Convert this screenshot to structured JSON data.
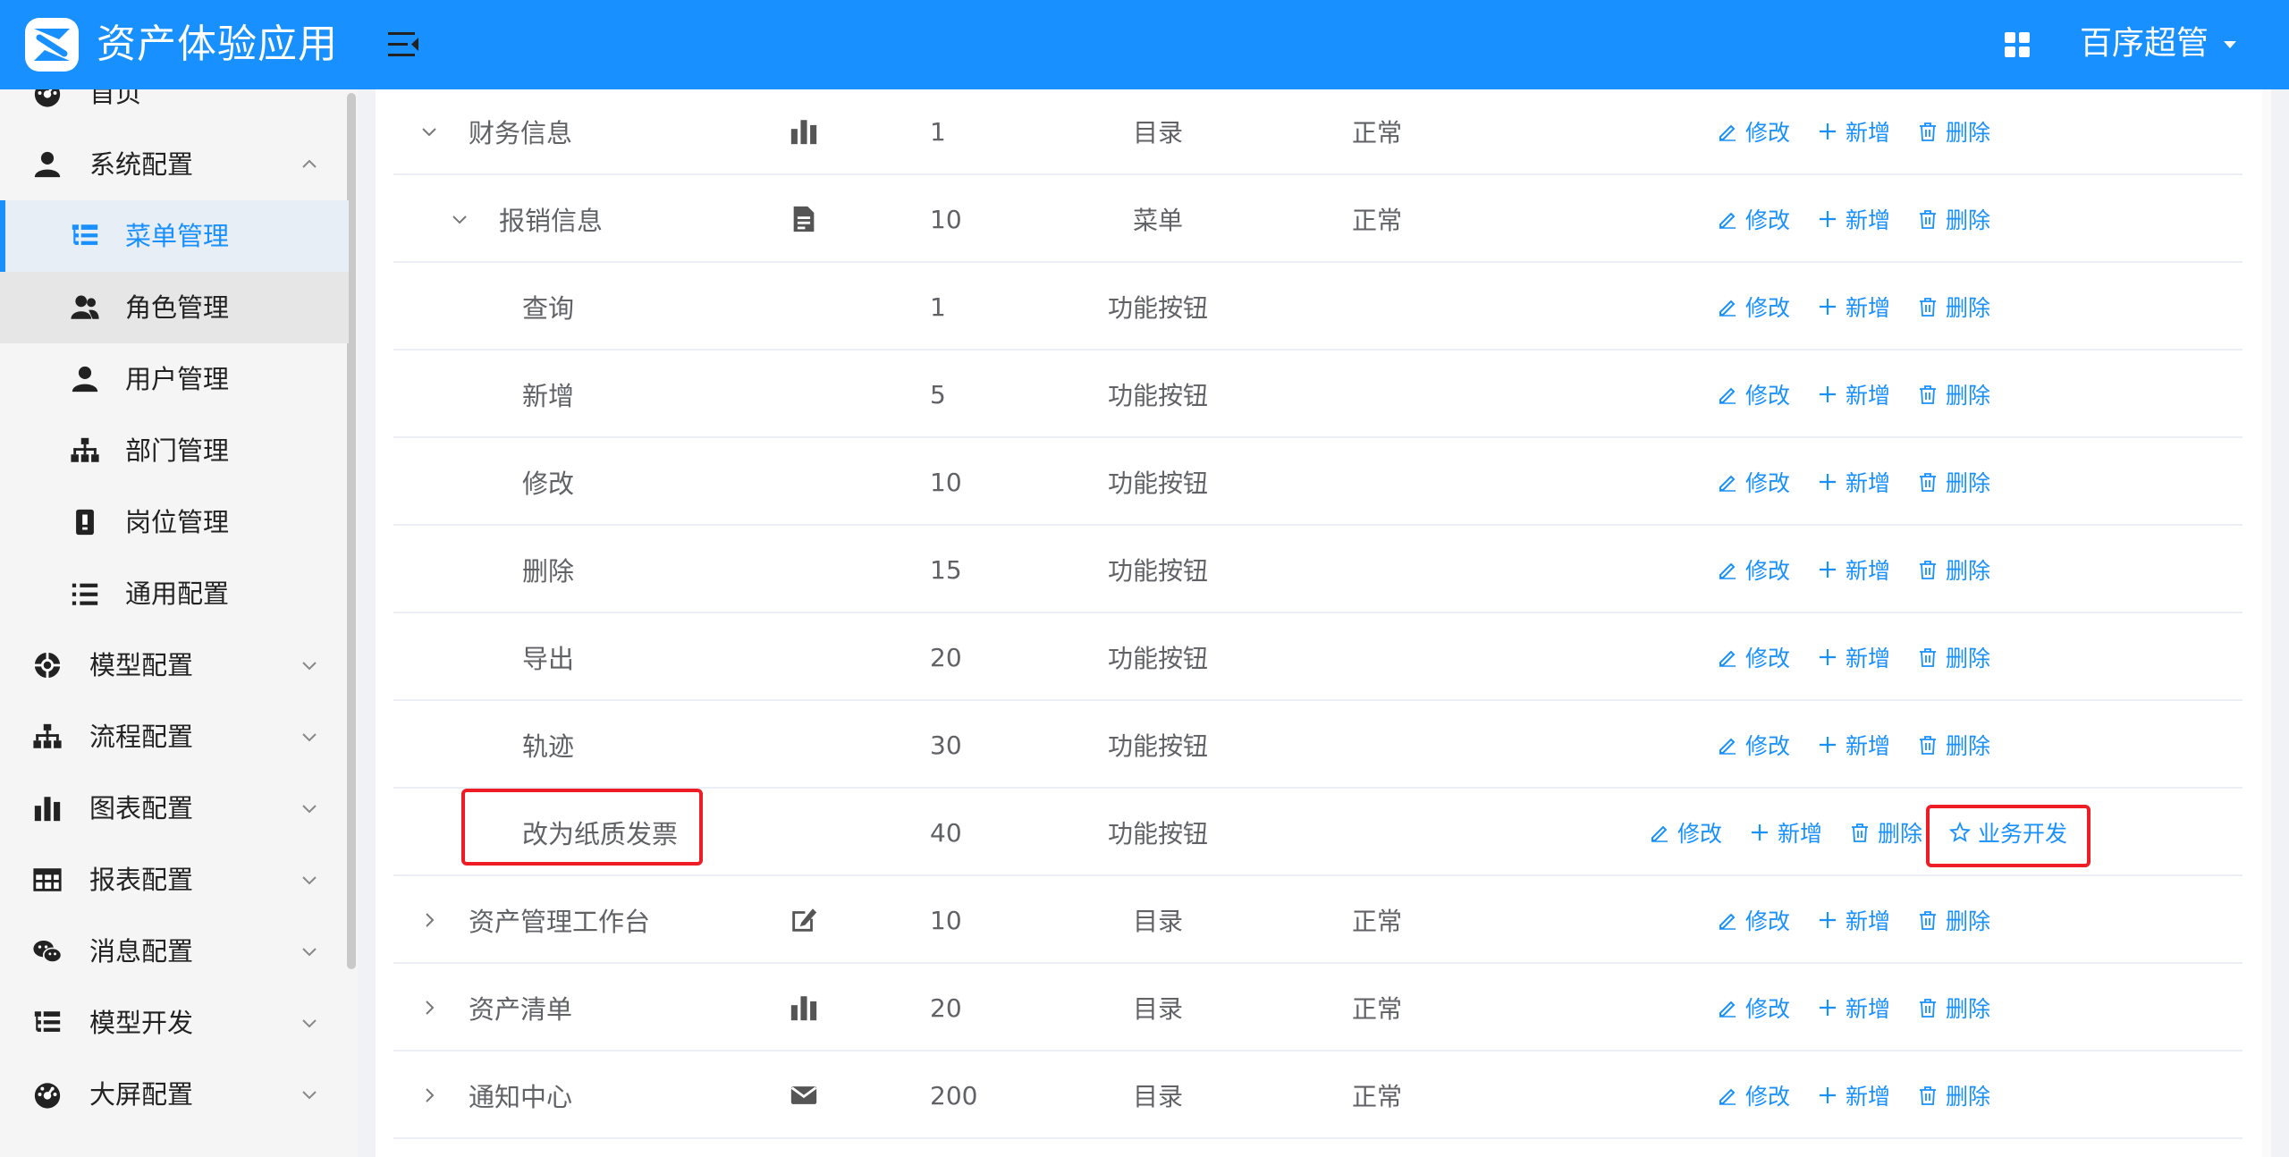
{
  "header": {
    "app_title": "资产体验应用",
    "user_name": "百序超管",
    "bg_color": "#1890ff"
  },
  "sidebar": {
    "items": [
      {
        "label": "首页",
        "icon": "dashboard-icon",
        "level": 1
      },
      {
        "label": "系统配置",
        "icon": "user-icon",
        "level": 1,
        "expanded": true
      },
      {
        "label": "菜单管理",
        "icon": "tree-table-icon",
        "level": 2,
        "active": true
      },
      {
        "label": "角色管理",
        "icon": "peoples-icon",
        "level": 2
      },
      {
        "label": "用户管理",
        "icon": "user-icon",
        "level": 2
      },
      {
        "label": "部门管理",
        "icon": "org-tree-icon",
        "level": 2
      },
      {
        "label": "岗位管理",
        "icon": "post-icon",
        "level": 2
      },
      {
        "label": "通用配置",
        "icon": "list-icon",
        "level": 2
      },
      {
        "label": "模型配置",
        "icon": "model-icon",
        "level": 1
      },
      {
        "label": "流程配置",
        "icon": "org-tree-icon",
        "level": 1
      },
      {
        "label": "图表配置",
        "icon": "bar-chart-icon",
        "level": 1
      },
      {
        "label": "报表配置",
        "icon": "table-icon",
        "level": 1
      },
      {
        "label": "消息配置",
        "icon": "wechat-icon",
        "level": 1
      },
      {
        "label": "模型开发",
        "icon": "tree-table-icon",
        "level": 1
      },
      {
        "label": "大屏配置",
        "icon": "dashboard-icon",
        "level": 1
      }
    ]
  },
  "actions": {
    "edit": "修改",
    "add": "新增",
    "delete": "删除",
    "biz_dev": "业务开发"
  },
  "table": {
    "rows": [
      {
        "name": "财务信息",
        "icon": "bar-chart-icon",
        "order": "1",
        "type": "目录",
        "status": "正常",
        "toggle": "expanded",
        "indent": 0
      },
      {
        "name": "报销信息",
        "icon": "document-icon",
        "order": "10",
        "type": "菜单",
        "status": "正常",
        "toggle": "expanded",
        "indent": 1
      },
      {
        "name": "查询",
        "icon": "",
        "order": "1",
        "type": "功能按钮",
        "status": "",
        "toggle": "",
        "indent": 2
      },
      {
        "name": "新增",
        "icon": "",
        "order": "5",
        "type": "功能按钮",
        "status": "",
        "toggle": "",
        "indent": 2
      },
      {
        "name": "修改",
        "icon": "",
        "order": "10",
        "type": "功能按钮",
        "status": "",
        "toggle": "",
        "indent": 2
      },
      {
        "name": "删除",
        "icon": "",
        "order": "15",
        "type": "功能按钮",
        "status": "",
        "toggle": "",
        "indent": 2
      },
      {
        "name": "导出",
        "icon": "",
        "order": "20",
        "type": "功能按钮",
        "status": "",
        "toggle": "",
        "indent": 2
      },
      {
        "name": "轨迹",
        "icon": "",
        "order": "30",
        "type": "功能按钮",
        "status": "",
        "toggle": "",
        "indent": 2
      },
      {
        "name": "改为纸质发票",
        "icon": "",
        "order": "40",
        "type": "功能按钮",
        "status": "",
        "toggle": "",
        "indent": 2,
        "has_biz_dev": true
      },
      {
        "name": "资产管理工作台",
        "icon": "edit-square-icon",
        "order": "10",
        "type": "目录",
        "status": "正常",
        "toggle": "collapsed",
        "indent": 0
      },
      {
        "name": "资产清单",
        "icon": "bar-chart-icon",
        "order": "20",
        "type": "目录",
        "status": "正常",
        "toggle": "collapsed",
        "indent": 0
      },
      {
        "name": "通知中心",
        "icon": "email-icon",
        "order": "200",
        "type": "目录",
        "status": "正常",
        "toggle": "collapsed",
        "indent": 0
      }
    ]
  },
  "colors": {
    "accent": "#1890ff",
    "highlight": "#ee1c25"
  }
}
